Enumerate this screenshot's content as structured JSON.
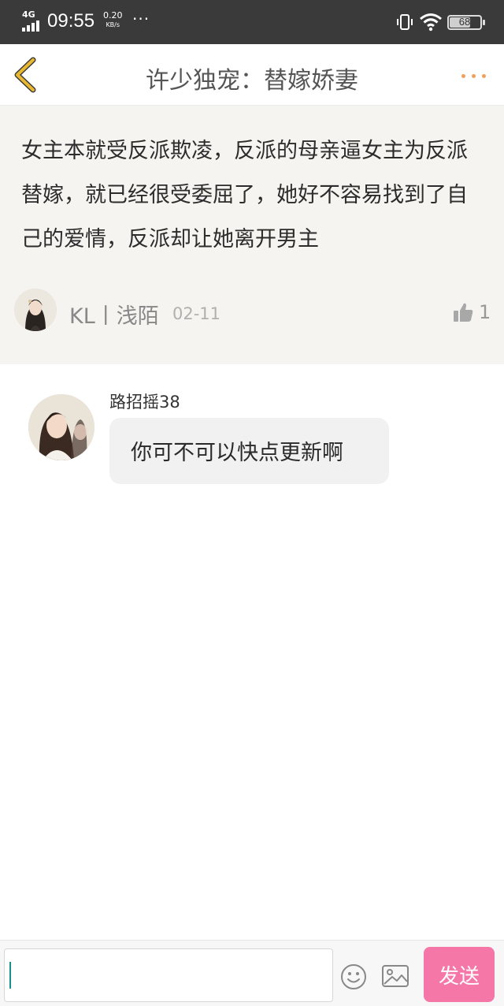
{
  "status_bar": {
    "network": "4G",
    "time": "09:55",
    "speed_value": "0.20",
    "speed_unit": "KB/s",
    "overflow": "···",
    "battery": "68"
  },
  "header": {
    "title": "许少独宠：替嫁娇妻"
  },
  "original_comment": {
    "text": "女主本就受反派欺凌，反派的母亲逼女主为反派替嫁，就已经很受委屈了，她好不容易找到了自己的爱情，反派却让她离开男主",
    "author": "KL丨浅陌",
    "date": "02-11",
    "likes": "1"
  },
  "reply": {
    "username": "路招摇38",
    "message": "你可不可以快点更新啊"
  },
  "input_bar": {
    "placeholder": "",
    "send_label": "发送"
  },
  "colors": {
    "status_bar_bg": "#3a3a3a",
    "accent_orange": "#f0a05a",
    "send_pink": "#f477a7",
    "back_arrow": "#e8b830",
    "comment_bg": "#f5f4f0"
  }
}
